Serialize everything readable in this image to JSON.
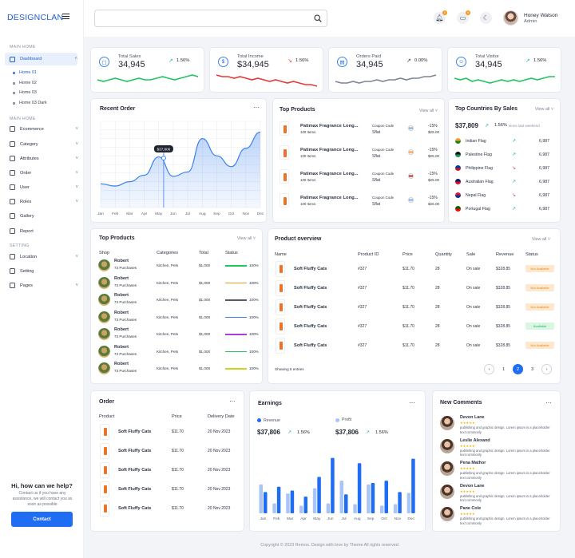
{
  "brand": {
    "name": "DESIGNCLAN"
  },
  "sidebar": {
    "section_main": "MAIN HOME",
    "dashboard": "Dashboard",
    "subs": [
      "Home 01",
      "Home 02",
      "Home 03",
      "Home 03 Dark"
    ],
    "section_main2": "MAIN HOME",
    "items": [
      "Ecommerce",
      "Category",
      "Attributes",
      "Order",
      "User",
      "Roles",
      "Gallery",
      "Report"
    ],
    "section_setting": "SETTING",
    "settings": [
      "Location",
      "Setting",
      "Pages"
    ],
    "help_title": "Hi, how can we help?",
    "help_text": "Contact us if you have any assistance, we will contact you as soon as possible",
    "contact_label": "Contact"
  },
  "topbar": {
    "search_placeholder": "",
    "notif_badge": "2",
    "msg_badge": "5",
    "user_name": "Honey Watson",
    "user_role": "Admin"
  },
  "stats": [
    {
      "label": "Total Sales",
      "value": "34,945",
      "pct": "1.56%",
      "icon": "bag-icon",
      "trend": "up",
      "color": "#22c55e",
      "spark": [
        8,
        7,
        8,
        9,
        8,
        7,
        8,
        9,
        8,
        8,
        9,
        10,
        9,
        8,
        9,
        10,
        11,
        10
      ]
    },
    {
      "label": "Total Income",
      "value": "$34,945",
      "pct": "1.56%",
      "icon": "dollar-icon",
      "trend": "down",
      "color": "#e53935",
      "spark": [
        11,
        10,
        10,
        9,
        10,
        9,
        8,
        9,
        8,
        7,
        8,
        7,
        6,
        7,
        6,
        5,
        5,
        4
      ]
    },
    {
      "label": "Orders Paid",
      "value": "34,945",
      "pct": "0.00%",
      "icon": "file-icon",
      "trend": "flat",
      "color": "#7d8594",
      "spark": [
        7,
        6,
        6,
        7,
        6,
        7,
        7,
        8,
        7,
        8,
        8,
        9,
        8,
        9,
        9,
        10,
        10,
        11
      ]
    },
    {
      "label": "Total Visitor",
      "value": "34,945",
      "pct": "1.56%",
      "icon": "users-icon",
      "trend": "up",
      "color": "#22c55e",
      "spark": [
        9,
        8,
        9,
        7,
        8,
        7,
        6,
        7,
        8,
        7,
        8,
        7,
        8,
        9,
        8,
        9,
        10,
        10
      ]
    }
  ],
  "recent_order": {
    "title": "Recent Order",
    "tooltip": "$37,806",
    "months": [
      "Jan",
      "Feb",
      "Mar",
      "Apr",
      "May",
      "Jun",
      "Jul",
      "Aug",
      "Sep",
      "Oct",
      "Nov",
      "Dec"
    ],
    "values": [
      22,
      20,
      24,
      30,
      47,
      29,
      33,
      64,
      48,
      38,
      55,
      70
    ],
    "ymax": 80
  },
  "top_products_a": {
    "title": "Top Products",
    "view_all": "View all",
    "items": [
      {
        "name": "Patimax Fragrance Long...",
        "sub": "100 Items",
        "code_label": "Coupon Code",
        "code": "Sflat",
        "pct": "-15%",
        "price": "$25.00",
        "flag": "ar"
      },
      {
        "name": "Patimax Fragrance Long...",
        "sub": "100 Items",
        "code_label": "Coupon Code",
        "code": "Sflat",
        "pct": "-15%",
        "price": "$25.00",
        "flag": "in"
      },
      {
        "name": "Patimax Fragrance Long...",
        "sub": "100 Items",
        "code_label": "Coupon Code",
        "code": "Sflat",
        "pct": "-15%",
        "price": "$25.00",
        "flag": "us"
      },
      {
        "name": "Patimax Fragrance Long...",
        "sub": "100 Items",
        "code_label": "Coupon Code",
        "code": "Sflat",
        "pct": "-15%",
        "price": "$25.00",
        "flag": "ar"
      }
    ]
  },
  "top_countries": {
    "title": "Top Countries By Sales",
    "view_all": "View all",
    "total": "$37,809",
    "pct": "1.56%",
    "since": "since last weekend",
    "items": [
      {
        "name": "Indian Flag",
        "value": "6,987",
        "trend": "up",
        "c1": "#ff9933",
        "c2": "#138808"
      },
      {
        "name": "Palestine Flag",
        "value": "6,987",
        "trend": "up",
        "c1": "#111111",
        "c2": "#149954"
      },
      {
        "name": "Philippine Flag",
        "value": "6,987",
        "trend": "down",
        "c1": "#0038a8",
        "c2": "#ce1126"
      },
      {
        "name": "Australian Flag",
        "value": "6,987",
        "trend": "up",
        "c1": "#012169",
        "c2": "#e4002b"
      },
      {
        "name": "Nepal Flag",
        "value": "6,987",
        "trend": "down",
        "c1": "#dc143c",
        "c2": "#003893"
      },
      {
        "name": "Portugal Flag",
        "value": "6,987",
        "trend": "up",
        "c1": "#006600",
        "c2": "#ff0000"
      }
    ]
  },
  "top_products_b": {
    "title": "Top Products",
    "view_all": "View all",
    "headers": [
      "Shop",
      "Categories",
      "Total",
      "Status"
    ],
    "rows": [
      {
        "name": "Robert",
        "sub": "73 Purchases",
        "cat": "Kitchen,  Pets",
        "total": "$1,000",
        "pct": "100%",
        "bar": "#22c55e"
      },
      {
        "name": "Robert",
        "sub": "73 Purchases",
        "cat": "Kitchen,  Pets",
        "total": "$1,000",
        "pct": "100%",
        "bar": "#f39a1f"
      },
      {
        "name": "Robert",
        "sub": "73 Purchases",
        "cat": "Kitchen,  Pets",
        "total": "$1,000",
        "pct": "100%",
        "bar": "#555a66"
      },
      {
        "name": "Robert",
        "sub": "73 Purchases",
        "cat": "Kitchen,  Pets",
        "total": "$1,000",
        "pct": "100%",
        "bar": "#3c82f0"
      },
      {
        "name": "Robert",
        "sub": "73 Purchases",
        "cat": "Kitchen,  Pets",
        "total": "$1,000",
        "pct": "100%",
        "bar": "#b03cd8"
      },
      {
        "name": "Robert",
        "sub": "73 Purchases",
        "cat": "Kitchen,  Pets",
        "total": "$1,000",
        "pct": "100%",
        "bar": "#22c55e"
      },
      {
        "name": "Robert",
        "sub": "73 Purchases",
        "cat": "Kitchen,  Pets",
        "total": "$1,000",
        "pct": "100%",
        "bar": "#c8d61f"
      }
    ]
  },
  "product_overview": {
    "title": "Product overview",
    "view_all": "View all",
    "headers": [
      "Name",
      "Product ID",
      "Price",
      "Quantity",
      "Sale",
      "Revenue",
      "Status"
    ],
    "rows": [
      {
        "name": "Soft Fluffy Cats",
        "id": "#327",
        "price": "$11.70",
        "qty": "28",
        "sale": "On sale",
        "rev": "$328.85",
        "status": "Not Available",
        "ok": false
      },
      {
        "name": "Soft Fluffy Cats",
        "id": "#327",
        "price": "$11.70",
        "qty": "28",
        "sale": "On sale",
        "rev": "$328.85",
        "status": "Not Available",
        "ok": false
      },
      {
        "name": "Soft Fluffy Cats",
        "id": "#327",
        "price": "$11.70",
        "qty": "28",
        "sale": "On sale",
        "rev": "$328.85",
        "status": "Not Available",
        "ok": false
      },
      {
        "name": "Soft Fluffy Cats",
        "id": "#327",
        "price": "$11.70",
        "qty": "28",
        "sale": "On sale",
        "rev": "$328.85",
        "status": "Available",
        "ok": true
      },
      {
        "name": "Soft Fluffy Cats",
        "id": "#327",
        "price": "$11.70",
        "qty": "28",
        "sale": "On sale",
        "rev": "$328.85",
        "status": "Not Available",
        "ok": false
      }
    ],
    "showing": "Showing 5 entries",
    "pages": [
      "1",
      "2",
      "3"
    ],
    "prev": "‹",
    "next": "›"
  },
  "order": {
    "title": "Order",
    "headers": [
      "Product",
      "Price",
      "Delivery Date"
    ],
    "rows": [
      {
        "name": "Soft Fluffy Cats",
        "price": "$11.70",
        "date": "20 Nov 2023"
      },
      {
        "name": "Soft Fluffy Cats",
        "price": "$11.70",
        "date": "20 Nov 2023"
      },
      {
        "name": "Soft Fluffy Cats",
        "price": "$11.70",
        "date": "20 Nov 2023"
      },
      {
        "name": "Soft Fluffy Cats",
        "price": "$11.70",
        "date": "20 Nov 2023"
      },
      {
        "name": "Soft Fluffy Cats",
        "price": "$11.70",
        "date": "20 Nov 2023"
      }
    ]
  },
  "earnings": {
    "title": "Earnings",
    "legend": [
      {
        "label": "Revenue",
        "color": "#1f6df2"
      },
      {
        "label": "Profit",
        "color": "#a9c4f7"
      }
    ],
    "revenue_total": "$37,806",
    "revenue_pct": "1.56%",
    "profit_total": "$37,806",
    "profit_pct": "1.56%"
  },
  "chart_data": {
    "type": "bar",
    "categories": [
      "Jan",
      "Feb",
      "Mar",
      "Apr",
      "May",
      "Jun",
      "Jul",
      "Aug",
      "Sep",
      "Oct",
      "Nov",
      "Dec"
    ],
    "series": [
      {
        "name": "Revenue",
        "values": [
          28,
          35,
          30,
          22,
          48,
          73,
          25,
          66,
          40,
          43,
          28,
          72
        ]
      },
      {
        "name": "Profit",
        "values": [
          38,
          13,
          26,
          10,
          33,
          13,
          43,
          12,
          38,
          10,
          12,
          27
        ]
      }
    ],
    "ylim": [
      0,
      80
    ]
  },
  "comments": {
    "title": "New Comments",
    "items": [
      {
        "name": "Devon Lane",
        "stars": "★★★★★",
        "text": "publishing and graphic design. Lorem ipsum is a placeholder text commonly"
      },
      {
        "name": "Leslie Alexand",
        "stars": "★★★★★",
        "text": "publishing and graphic design. Lorem ipsum is a placeholder text commonly"
      },
      {
        "name": "Pena Mathor",
        "stars": "★★★★★",
        "text": "publishing and graphic design. Lorem ipsum is a placeholder text commonly"
      },
      {
        "name": "Devon Lane",
        "stars": "★★★★★",
        "text": "publishing and graphic design. Lorem ipsum is a placeholder text commonly"
      },
      {
        "name": "Pane Cole",
        "stars": "★★★★★",
        "text": "publishing and graphic design. Lorem ipsum is a placeholder text commonly"
      }
    ]
  },
  "footer": {
    "copyright": "Copyright © 2023 Remos. Design with love by Theme All rights reserved"
  }
}
